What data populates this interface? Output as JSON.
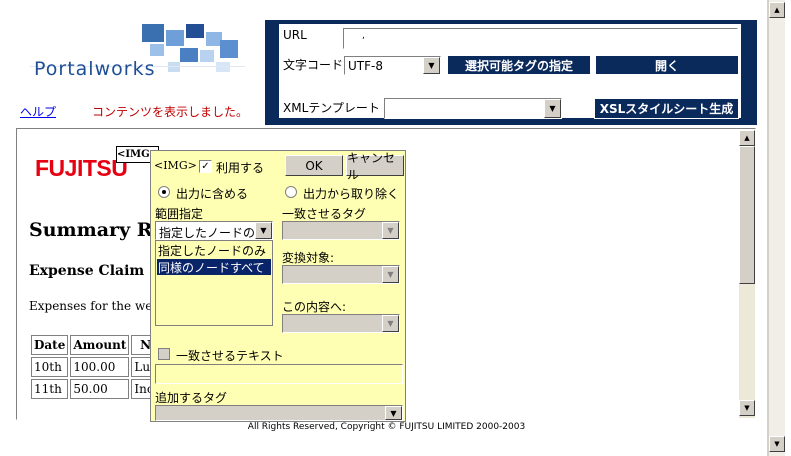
{
  "header": {
    "logo_text": "Portalworks",
    "help_link": "ヘルプ",
    "status": "コンテンツを表示しました。"
  },
  "toolbar": {
    "url_label": "URL",
    "url_value": ",",
    "encoding_label": "文字コード",
    "encoding_value": "UTF-8",
    "select_tag_button": "選択可能タグの指定",
    "open_button": "開く",
    "xml_template_label": "XMLテンプレート",
    "xml_template_value": "",
    "xsl_button": "XSLスタイルシート生成"
  },
  "content": {
    "brand": "FUJITSU",
    "img_tag_label": "<IMG>",
    "title": "Summary Rep",
    "subtitle": "Expense Claim",
    "text": "Expenses for the week",
    "table": {
      "headers": [
        "Date",
        "Amount",
        "Note"
      ],
      "rows": [
        [
          "10th",
          "100.00",
          "Lunch"
        ],
        [
          "11th",
          "50.00",
          "Incider"
        ]
      ]
    }
  },
  "panel": {
    "tag": "<IMG>",
    "use_label": "利用する",
    "ok": "OK",
    "cancel": "キャンセル",
    "include_label": "出力に含める",
    "exclude_label": "出力から取り除く",
    "scope_label": "範囲指定",
    "scope_value": "指定したノードのみ",
    "scope_options": [
      "指定したノードのみ",
      "同様のノードすべて"
    ],
    "match_tag_label": "一致させるタグ",
    "convert_label": "変換対象:",
    "content_label": "この内容へ:",
    "match_text_label": "一致させるテキスト",
    "add_tag_label": "追加するタグ"
  },
  "footer": {
    "copyright": "All Rights Reserved, Copyright © FUJITSU LIMITED 2000-2003"
  },
  "colors": {
    "navy": "#0b2a5c",
    "panel_yellow": "#ffffb3",
    "fujitsu_red": "#e60012",
    "status_red": "#c00000",
    "link_blue": "#0000ee",
    "selection": "#0a246a"
  }
}
